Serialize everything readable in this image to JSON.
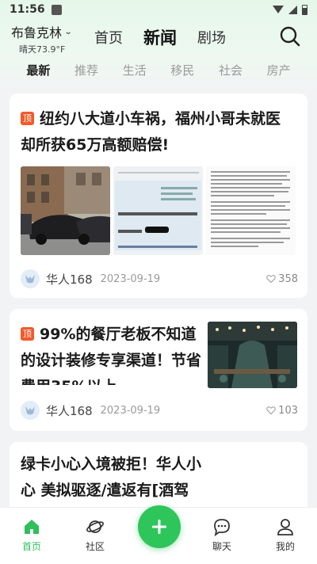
{
  "status_bar": {
    "time": "11:56"
  },
  "header": {
    "city": "布鲁克林",
    "weather": "晴天73.9°F",
    "tabs": [
      {
        "label": "首页",
        "active": false
      },
      {
        "label": "新闻",
        "active": true
      },
      {
        "label": "剧场",
        "active": false
      }
    ]
  },
  "categories": [
    "最新",
    "推荐",
    "生活",
    "移民",
    "社会",
    "房产"
  ],
  "active_category": "最新",
  "feed": [
    {
      "pinned": true,
      "pin_label": "顶",
      "title": "纽约八大道小车祸，福州小哥未就医却所获65万高额赔偿!",
      "author": "华人168",
      "date": "2023-09-19",
      "likes": "358"
    },
    {
      "pinned": true,
      "pin_label": "顶",
      "title": "99%的餐厅老板不知道的设计装修专享渠道！节省费用35%以上",
      "author": "华人168",
      "date": "2023-09-19",
      "likes": "103"
    },
    {
      "pinned": false,
      "title": "绿卡小心入境被拒！华人小心 美拟驱逐/遣返有[酒驾纪"
    }
  ],
  "bottom_nav": [
    {
      "label": "首页",
      "icon": "home-icon",
      "active": true
    },
    {
      "label": "社区",
      "icon": "planet-icon",
      "active": false
    },
    {
      "label": "聊天",
      "icon": "chat-icon",
      "active": false
    },
    {
      "label": "我的",
      "icon": "profile-icon",
      "active": false
    }
  ],
  "colors": {
    "accent": "#2ec55a",
    "pin": "#f15a2b"
  }
}
